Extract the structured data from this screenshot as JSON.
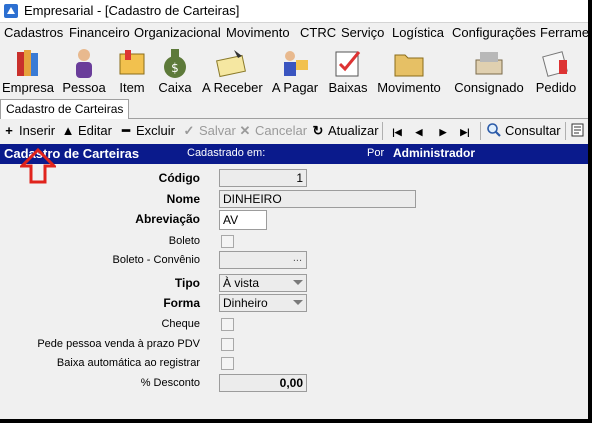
{
  "window": {
    "title": "Empresarial - [Cadastro de Carteiras]"
  },
  "menu": [
    "Cadastros",
    "Financeiro",
    "Organizacional",
    "Movimento",
    "CTRC",
    "Serviço",
    "Logística",
    "Configurações",
    "Ferramentas"
  ],
  "bigbar": [
    {
      "label": "Empresa",
      "icon": "books-icon"
    },
    {
      "label": "Pessoa",
      "icon": "person-icon"
    },
    {
      "label": "Item",
      "icon": "item-box-icon"
    },
    {
      "label": "Caixa",
      "icon": "money-bag-icon"
    },
    {
      "label": "A Receber",
      "icon": "receive-icon"
    },
    {
      "label": "A Pagar",
      "icon": "pay-icon"
    },
    {
      "label": "Baixas",
      "icon": "baixas-icon"
    },
    {
      "label": "Movimento",
      "icon": "folder-icon"
    },
    {
      "label": "Consignado",
      "icon": "consignment-icon"
    },
    {
      "label": "Pedido",
      "icon": "order-icon"
    }
  ],
  "tab": {
    "label": "Cadastro de Carteiras"
  },
  "toolbar": {
    "inserir": "Inserir",
    "editar": "Editar",
    "excluir": "Excluir",
    "salvar": "Salvar",
    "cancelar": "Cancelar",
    "atualizar": "Atualizar",
    "consultar": "Consultar"
  },
  "header": {
    "title": "Cadastro de Carteiras",
    "cadastrado": "Cadastrado em:",
    "por": "Por",
    "user": "Administrador"
  },
  "form": {
    "codigo": {
      "label": "Código",
      "value": "1"
    },
    "nome": {
      "label": "Nome",
      "value": "DINHEIRO"
    },
    "abreviacao": {
      "label": "Abreviação",
      "value": "AV"
    },
    "boleto": {
      "label": "Boleto"
    },
    "boleto_convenio": {
      "label": "Boleto - Convênio",
      "button": "..."
    },
    "tipo": {
      "label": "Tipo",
      "value": "À vista"
    },
    "forma": {
      "label": "Forma",
      "value": "Dinheiro"
    },
    "cheque": {
      "label": "Cheque"
    },
    "pede_pessoa": {
      "label": "Pede pessoa venda à prazo PDV"
    },
    "baixa_automatica": {
      "label": "Baixa automática ao registrar"
    },
    "desconto": {
      "label": "% Desconto",
      "value": "0,00"
    }
  },
  "colors": {
    "header_bg": "#0a1a8c",
    "annotation": "#e0231c"
  }
}
